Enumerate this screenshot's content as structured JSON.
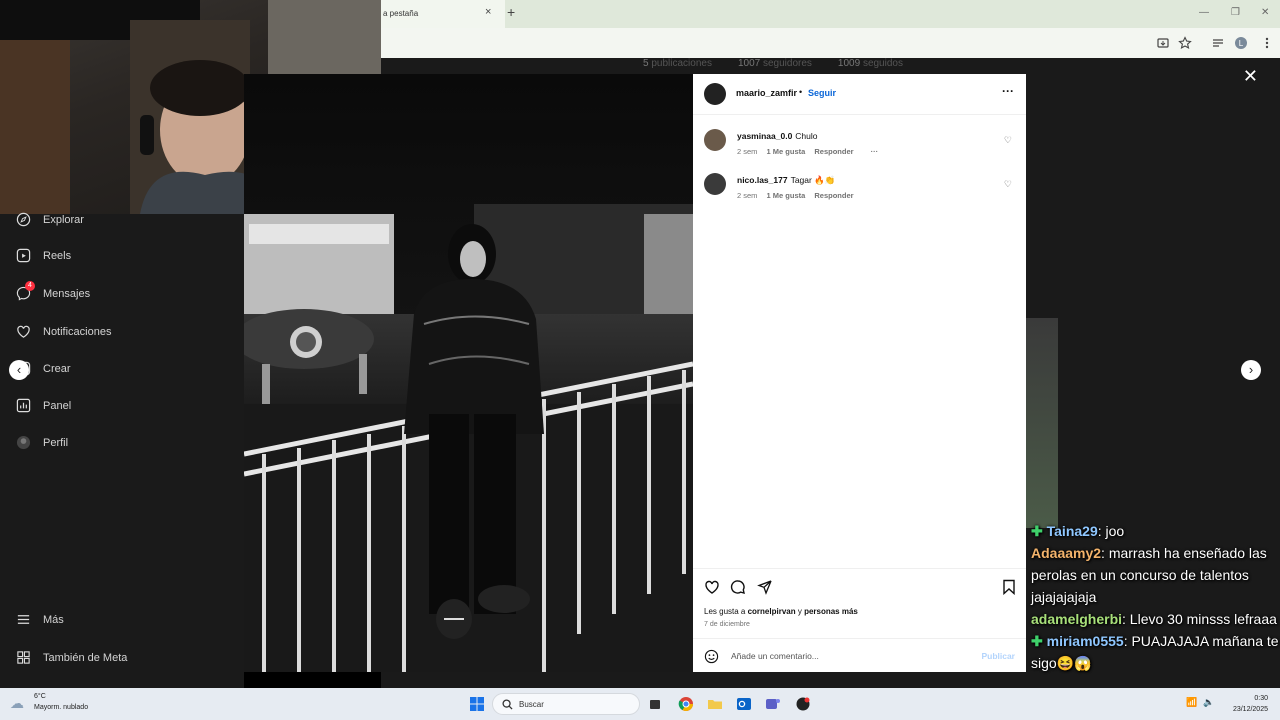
{
  "browser": {
    "tab_title": "a pestaña",
    "tab_close": "×",
    "new_tab": "+"
  },
  "profile_stats": [
    {
      "num": "5",
      "label": "publicaciones"
    },
    {
      "num": "1007",
      "label": "seguidores"
    },
    {
      "num": "1009",
      "label": "seguidos"
    }
  ],
  "sidebar": {
    "items": [
      {
        "label": "Explorar",
        "icon": "compass-icon"
      },
      {
        "label": "Reels",
        "icon": "reels-icon"
      },
      {
        "label": "Mensajes",
        "icon": "messenger-icon",
        "badge": "4"
      },
      {
        "label": "Notificaciones",
        "icon": "heart-icon"
      },
      {
        "label": "Crear",
        "icon": "plus-icon"
      },
      {
        "label": "Panel",
        "icon": "chart-icon"
      },
      {
        "label": "Perfil",
        "icon": "avatar-icon"
      },
      {
        "label": "Más",
        "icon": "menu-icon"
      },
      {
        "label": "También de Meta",
        "icon": "meta-icon"
      }
    ]
  },
  "post": {
    "author": "maario_zamfir",
    "separator": "•",
    "follow": "Seguir",
    "more": "···",
    "comments": [
      {
        "user": "yasminaa_0.0",
        "text": "Chulo",
        "time": "2 sem",
        "likes": "1 Me gusta",
        "reply": "Responder",
        "more": "···"
      },
      {
        "user": "nico.las_177",
        "text": "Tagar 🔥👏",
        "time": "2 sem",
        "likes": "1 Me gusta",
        "reply": "Responder"
      }
    ],
    "likes_prefix": "Les gusta a ",
    "likes_user": "cornelpirvan",
    "likes_and": " y ",
    "likes_others": "personas más",
    "date": "7 de diciembre",
    "comment_placeholder": "Añade un comentario...",
    "publish": "Publicar"
  },
  "overlay": {
    "close": "✕",
    "prev": "‹",
    "next": "›"
  },
  "chat": [
    {
      "user": "Taina29",
      "color": "#8fc7ff",
      "msg": ": joo",
      "badge": true
    },
    {
      "user": "Adaaamy2",
      "color": "#f3b36b",
      "msg": ": marrash ha enseñado las perolas en un concurso de talentos jajajajajaja",
      "badge": false
    },
    {
      "user": "adamelgherbi",
      "color": "#a8e07a",
      "msg": ": Llevo 30 minsss lefraaa",
      "badge": false
    },
    {
      "user": "miriam0555",
      "color": "#8fc7ff",
      "msg": ": PUAJAJAJA mañana te sigo😆😱",
      "badge": true
    }
  ],
  "taskbar": {
    "weather_temp": "6°C",
    "weather_desc": "Mayorm. nublado",
    "search": "Buscar",
    "time": "0:30",
    "date": "23/12/2025"
  }
}
